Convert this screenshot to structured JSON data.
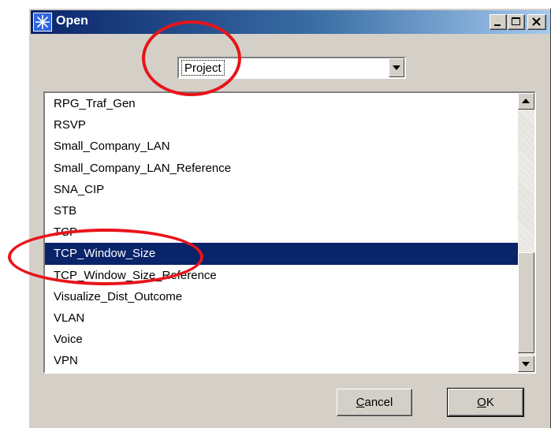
{
  "window": {
    "title": "Open",
    "controls": {
      "minimize_glyph": "_",
      "maximize_glyph": "□",
      "close_glyph": "×"
    }
  },
  "type_selector": {
    "selected": "Project",
    "arrow_glyph": "▼"
  },
  "list": {
    "items": [
      {
        "label": "RPG_Traf_Gen",
        "selected": false
      },
      {
        "label": "RSVP",
        "selected": false
      },
      {
        "label": "Small_Company_LAN",
        "selected": false
      },
      {
        "label": "Small_Company_LAN_Reference",
        "selected": false
      },
      {
        "label": "SNA_CIP",
        "selected": false
      },
      {
        "label": "STB",
        "selected": false
      },
      {
        "label": "TCP",
        "selected": false
      },
      {
        "label": "TCP_Window_Size",
        "selected": true
      },
      {
        "label": "TCP_Window_Size_Reference",
        "selected": false
      },
      {
        "label": "Visualize_Dist_Outcome",
        "selected": false
      },
      {
        "label": "VLAN",
        "selected": false
      },
      {
        "label": "Voice",
        "selected": false
      },
      {
        "label": "VPN",
        "selected": false
      }
    ],
    "scroll_up_glyph": "▲",
    "scroll_down_glyph": "▼"
  },
  "buttons": {
    "cancel": {
      "mnemonic": "C",
      "rest": "ancel"
    },
    "ok": {
      "mnemonic": "O",
      "rest": "K"
    }
  },
  "annotation_color": "#e8141a",
  "selection_color": "#0a246a"
}
